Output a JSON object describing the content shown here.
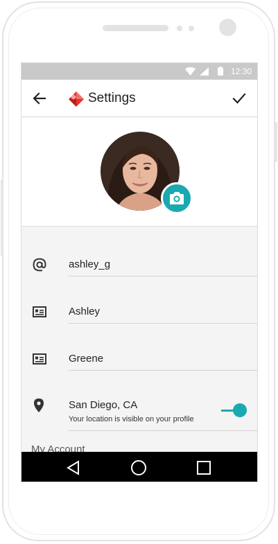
{
  "status_bar": {
    "time": "12:30",
    "icons": [
      "wifi-icon",
      "signal-icon",
      "battery-icon"
    ]
  },
  "app_bar": {
    "title": "Settings",
    "back_icon": "arrow-left-icon",
    "logo_icon": "app-logo-icon",
    "save_icon": "check-icon"
  },
  "profile": {
    "avatar": "profile-photo",
    "camera_icon": "camera-icon"
  },
  "fields": [
    {
      "icon": "at-sign-icon",
      "value": "ashley_g"
    },
    {
      "icon": "id-card-icon",
      "value": "Ashley"
    },
    {
      "icon": "id-card-icon",
      "value": "Greene"
    }
  ],
  "location": {
    "icon": "location-pin-icon",
    "value": "San Diego, CA",
    "subtitle": "Your location is visible on your profile",
    "visible_toggle_on": true
  },
  "section": {
    "my_account": "My Account"
  },
  "nav": [
    "back-triangle-icon",
    "home-circle-icon",
    "recents-square-icon"
  ],
  "colors": {
    "accent": "#1aa9b0",
    "logo_red": "#e8322d",
    "status_bar": "#c9c9c9",
    "nav_bar": "#000000"
  }
}
